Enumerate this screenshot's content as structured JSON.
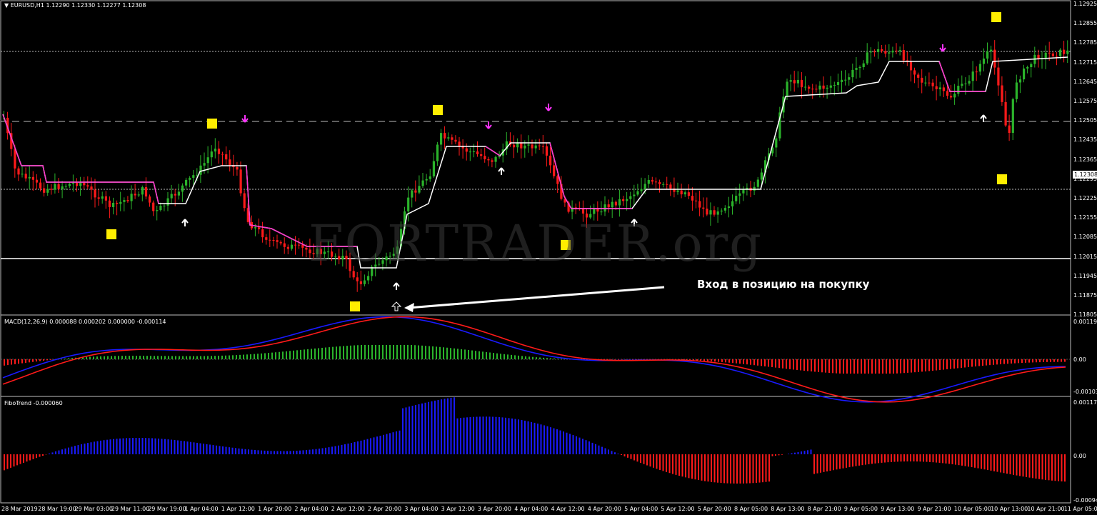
{
  "header": {
    "symbol_line": "EURUSD,H1  1.12290 1.12330 1.12277 1.12308"
  },
  "annotation": "Вход в позицию на покупку",
  "watermark": "FORTRADER.org",
  "current_price": "1.12308",
  "price_axis": [
    "1.12925",
    "1.12855",
    "1.12785",
    "1.12715",
    "1.12645",
    "1.12575",
    "1.12505",
    "1.12435",
    "1.12365",
    "1.12295",
    "1.12225",
    "1.12155",
    "1.12085",
    "1.12015",
    "1.11945",
    "1.11875",
    "1.11805"
  ],
  "macd": {
    "title": "MACD(12,26,9) 0.000088 0.000202 0.000000 -0.000114",
    "axis": [
      "0.001192",
      "0.00",
      "-0.001036"
    ]
  },
  "fibotrend": {
    "title": "FiboTrend -0.000060",
    "axis": [
      "0.001173",
      "0.00",
      "-0.000945"
    ]
  },
  "time_axis": [
    "28 Mar 2019",
    "28 Mar 19:00",
    "29 Mar 03:00",
    "29 Mar 11:00",
    "29 Mar 19:00",
    "1 Apr 04:00",
    "1 Apr 12:00",
    "1 Apr 20:00",
    "2 Apr 04:00",
    "2 Apr 12:00",
    "2 Apr 20:00",
    "3 Apr 04:00",
    "3 Apr 12:00",
    "3 Apr 20:00",
    "4 Apr 04:00",
    "4 Apr 12:00",
    "4 Apr 20:00",
    "5 Apr 04:00",
    "5 Apr 12:00",
    "5 Apr 20:00",
    "8 Apr 05:00",
    "8 Apr 13:00",
    "8 Apr 21:00",
    "9 Apr 05:00",
    "9 Apr 13:00",
    "9 Apr 21:00",
    "10 Apr 05:00",
    "10 Apr 13:00",
    "10 Apr 21:00",
    "11 Apr 05:00"
  ],
  "colors": {
    "bull": "#2bb32b",
    "bear": "#ff1a1a",
    "trend_up": "#ffffff",
    "trend_down": "#ff33cc",
    "signal_box": "#ffee00",
    "macd_line": "#1a1aff",
    "signal_line": "#ff1a1a",
    "fibo_pos": "#1a1aff",
    "fibo_neg": "#ff1a1a"
  }
}
